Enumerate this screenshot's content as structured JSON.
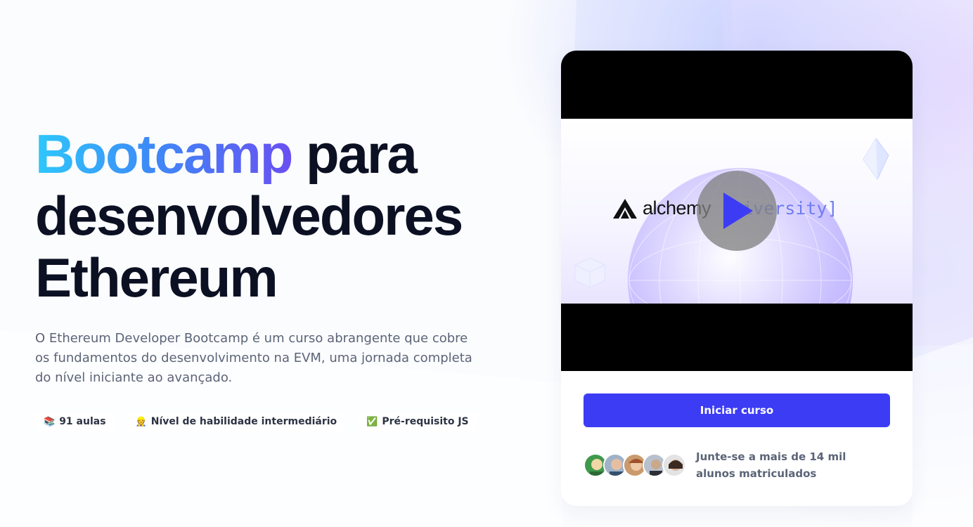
{
  "hero": {
    "title_highlight": "Bootcamp",
    "title_rest_1": " para",
    "title_rest_2": "desenvolvedores",
    "title_rest_3": "Ethereum",
    "description": "O Ethereum Developer Bootcamp é um curso abrangente que cobre os fundamentos do desenvolvimento na EVM, uma jornada completa do nível iniciante ao avançado."
  },
  "chips": [
    {
      "icon": "📚",
      "icon_name": "books-icon",
      "label": "91 aulas"
    },
    {
      "icon": "👷",
      "icon_name": "construction-worker-icon",
      "label": "Nível de habilidade intermediário"
    },
    {
      "icon": "✅",
      "icon_name": "check-mark-icon",
      "label": "Pré-requisito JS"
    }
  ],
  "video": {
    "logo_word": "alchemy",
    "logo_suffix": "niversity]",
    "icon": "play-icon"
  },
  "card": {
    "cta_label": "Iniciar curso",
    "social_text": "Junte-se a mais de 14 mil alunos matriculados"
  },
  "colors": {
    "accent": "#3c3cf5",
    "gradient_start": "#2ec8fb",
    "gradient_end": "#6a4ff2",
    "title": "#0c1023",
    "body_text": "#5b6477"
  }
}
